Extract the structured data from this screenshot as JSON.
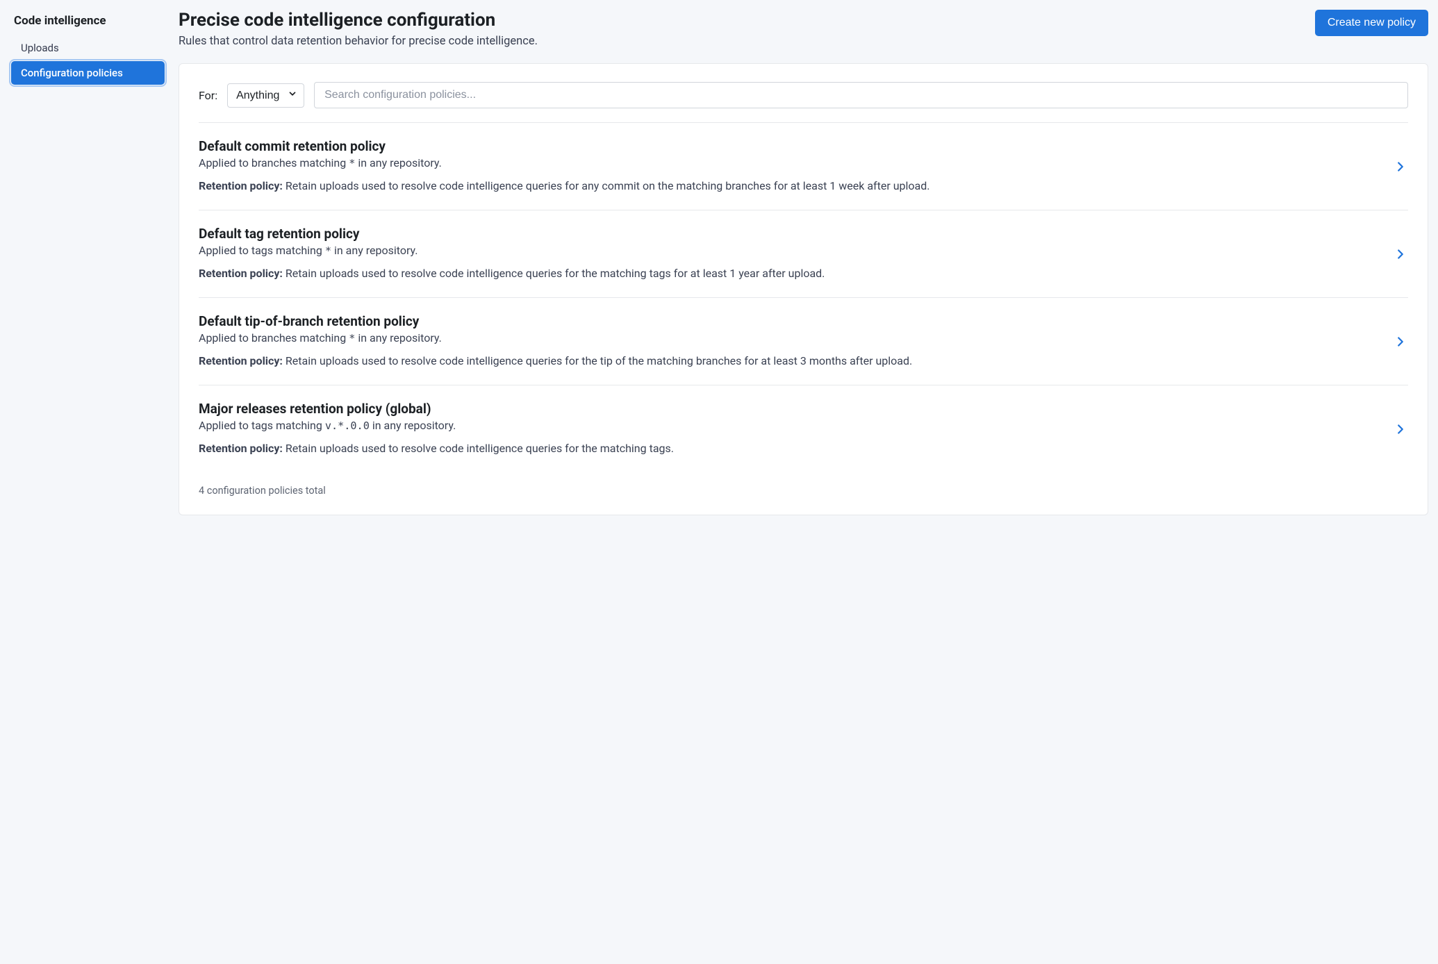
{
  "sidebar": {
    "title": "Code intelligence",
    "items": [
      {
        "label": "Uploads",
        "active": false
      },
      {
        "label": "Configuration policies",
        "active": true
      }
    ]
  },
  "header": {
    "title": "Precise code intelligence configuration",
    "subtitle": "Rules that control data retention behavior for precise code intelligence.",
    "create_button": "Create new policy"
  },
  "filters": {
    "for_label": "For:",
    "for_value": "Anything",
    "search_placeholder": "Search configuration policies..."
  },
  "policies": [
    {
      "title": "Default commit retention policy",
      "applied_prefix": "Applied to branches matching ",
      "pattern": "*",
      "applied_suffix": " in any repository.",
      "retention_label": "Retention policy:",
      "retention_text": " Retain uploads used to resolve code intelligence queries for any commit on the matching branches for at least 1 week after upload."
    },
    {
      "title": "Default tag retention policy",
      "applied_prefix": "Applied to tags matching ",
      "pattern": "*",
      "applied_suffix": " in any repository.",
      "retention_label": "Retention policy:",
      "retention_text": " Retain uploads used to resolve code intelligence queries for the matching tags for at least 1 year after upload."
    },
    {
      "title": "Default tip-of-branch retention policy",
      "applied_prefix": "Applied to branches matching ",
      "pattern": "*",
      "applied_suffix": " in any repository.",
      "retention_label": "Retention policy:",
      "retention_text": " Retain uploads used to resolve code intelligence queries for the tip of the matching branches for at least 3 months after upload."
    },
    {
      "title": "Major releases retention policy (global)",
      "applied_prefix": "Applied to tags matching ",
      "pattern": "v.*.0.0",
      "applied_suffix": " in any repository.",
      "retention_label": "Retention policy:",
      "retention_text": " Retain uploads used to resolve code intelligence queries for the matching tags."
    }
  ],
  "footer": {
    "total": "4 configuration policies total"
  }
}
